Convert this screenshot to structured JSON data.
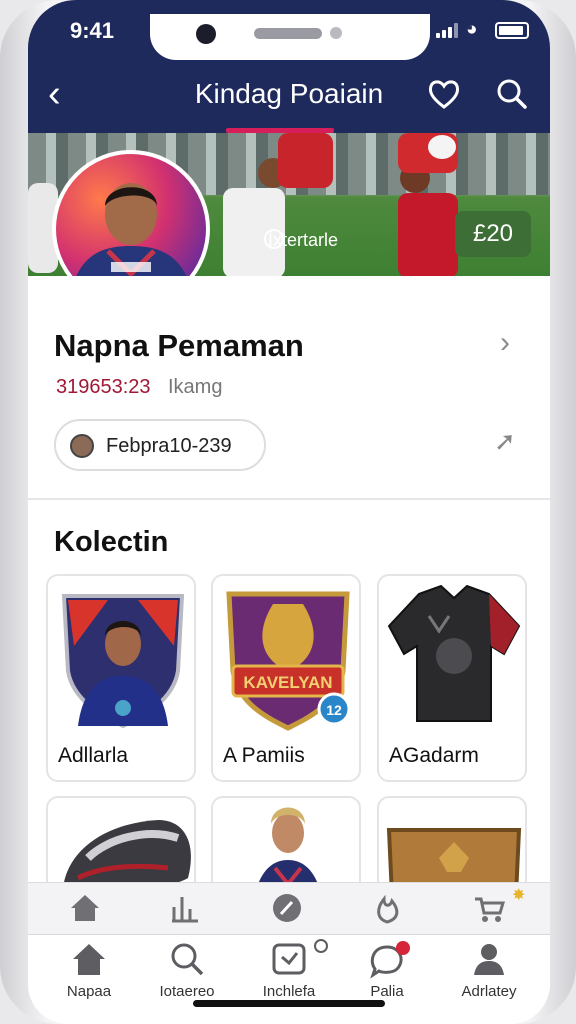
{
  "status": {
    "time": "9:41"
  },
  "header": {
    "title": "Kindag Poaiain"
  },
  "hero": {
    "overlay_text": "Ixtertarle",
    "price": "£20"
  },
  "profile": {
    "name": "Napna Pemaman",
    "id_number": "319653:23",
    "id_label": "Ikamg",
    "chip_text": "Febpra10-239"
  },
  "collection": {
    "title": "Kolectin",
    "items": [
      {
        "label": "Adllarla"
      },
      {
        "label": "A Pamiis"
      },
      {
        "label": "AGadarm"
      }
    ],
    "badge_text": "12",
    "banner_text": "KAVELYAN"
  },
  "bottom_nav": {
    "items": [
      {
        "label": "Napaa"
      },
      {
        "label": "Iotaereo"
      },
      {
        "label": "Inchlefa"
      },
      {
        "label": "Palia"
      },
      {
        "label": "Adrlatey"
      }
    ]
  },
  "colors": {
    "header_bg": "#1f2a5c",
    "accent": "#d61f5a",
    "price_bg": "#3c6e35"
  }
}
